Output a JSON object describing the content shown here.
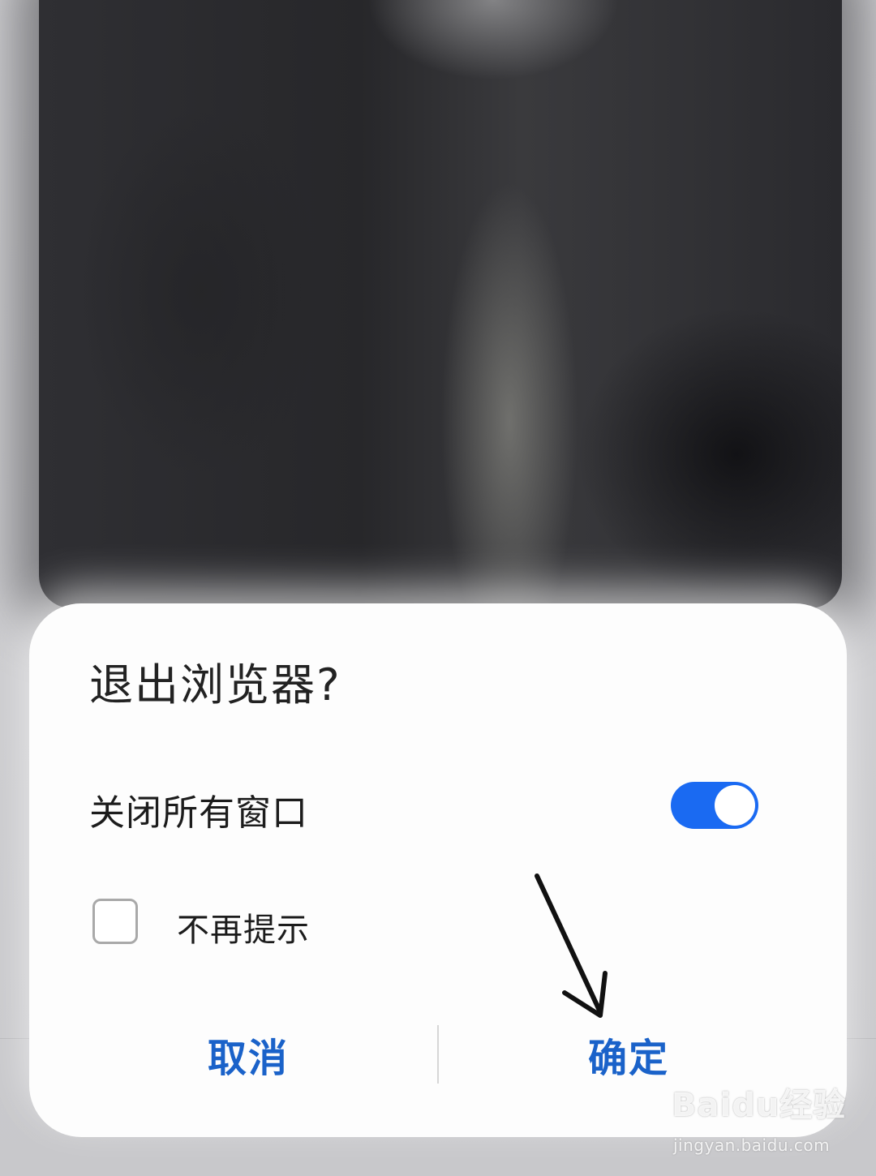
{
  "dialog": {
    "title": "退出浏览器?",
    "close_all_label": "关闭所有窗口",
    "close_all_enabled": true,
    "dont_remind_label": "不再提示",
    "dont_remind_checked": false,
    "cancel_label": "取消",
    "confirm_label": "确定",
    "accent_color": "#1a6af2",
    "button_text_color": "#1a62c9"
  },
  "watermark": {
    "logo": "Baidu经验",
    "url": "jingyan.baidu.com"
  }
}
